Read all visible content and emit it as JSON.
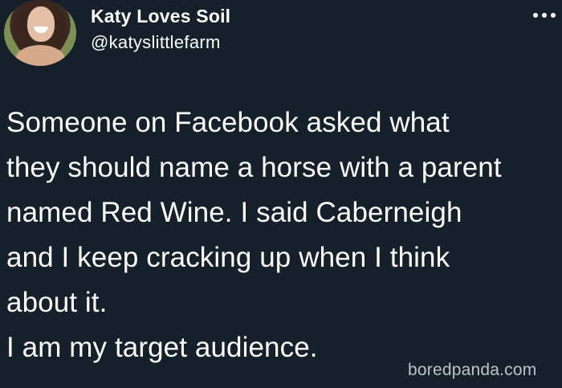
{
  "tweet": {
    "author": {
      "name": "Katy Loves Soil",
      "handle": "@katyslittlefarm"
    },
    "more_icon": "more-options-icon",
    "body_lines": [
      "Someone on Facebook asked what",
      "they should name a horse with a parent",
      "named Red Wine. I said Caberneigh",
      "and I keep cracking up when I think",
      "about it.",
      "I am my target audience."
    ]
  },
  "watermark": "boredpanda.com",
  "colors": {
    "background": "#15202b",
    "text": "#ffffff",
    "watermark": "#c9ccd1"
  }
}
